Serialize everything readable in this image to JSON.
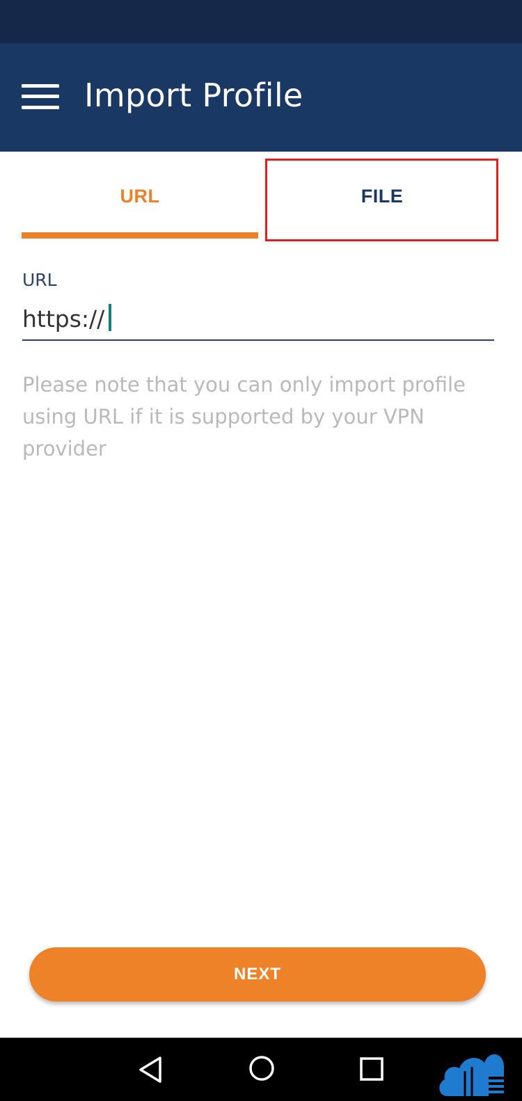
{
  "app_bar": {
    "title": "Import Profile",
    "menu_icon": "hamburger-menu-icon",
    "background_color": "#1a3864"
  },
  "tabs": [
    {
      "label": "URL",
      "selected": true,
      "color": "#eb8129"
    },
    {
      "label": "FILE",
      "selected": false,
      "color": "#1a3864"
    }
  ],
  "url_field": {
    "label": "URL",
    "value": "https://"
  },
  "note": "Please note that you can only import profile using URL if it is supported by your VPN provider",
  "next_button": {
    "label": "NEXT",
    "color": "#ee8229"
  },
  "nav_bar": {
    "icons": [
      "back-icon",
      "home-icon",
      "recents-icon"
    ],
    "logo": "cloud-logo"
  },
  "highlight_color": "#e31d1d"
}
